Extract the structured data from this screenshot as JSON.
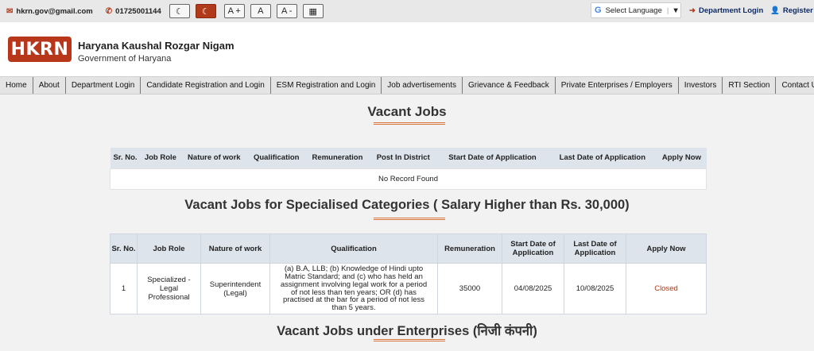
{
  "topbar": {
    "email": "hkrn.gov@gmail.com",
    "phone": "01725001144",
    "buttons": [
      "☾",
      "☾",
      "A +",
      "A",
      "A -",
      "▦"
    ],
    "language": {
      "g": "G",
      "label": "Select Language",
      "arrow": "▼"
    },
    "department_login": "Department Login",
    "register": "Register"
  },
  "header": {
    "logo_text": "HKRN",
    "org_name": "Haryana Kaushal Rozgar Nigam",
    "org_sub": "Government of Haryana"
  },
  "nav": [
    "Home",
    "About",
    "Department Login",
    "Candidate Registration and Login",
    "ESM Registration and Login",
    "Job advertisements",
    "Grievance & Feedback",
    "Private Enterprises / Employers",
    "Investors",
    "RTI Section",
    "Contact Us"
  ],
  "vacant_jobs": {
    "title": "Vacant Jobs",
    "headers": [
      "Sr. No.",
      "Job Role",
      "Nature of work",
      "Qualification",
      "Remuneration",
      "Post In District",
      "Start Date of Application",
      "Last Date of Application",
      "Apply Now"
    ],
    "empty_text": "No Record Found"
  },
  "specialised": {
    "title": "Vacant Jobs for Specialised Categories ( Salary Higher than  Rs. 30,000)",
    "headers": [
      "Sr. No.",
      "Job Role",
      "Nature of work",
      "Qualification",
      "Remuneration",
      "Start Date of Application",
      "Last Date of Application",
      "Apply Now"
    ],
    "row": {
      "sr": "1",
      "role": "Specialized - Legal Professional",
      "nature": "Superintendent (Legal)",
      "qualification": "(a) B.A, LLB; (b) Knowledge of Hindi upto Matric Standard; and (c) who has held an assignment involving legal work for a period of not less than ten years; OR (d) has practised at the bar for a period of not less than 5 years.",
      "remuneration": "35000",
      "start": "04/08/2025",
      "last": "10/08/2025",
      "apply": "Closed"
    }
  },
  "enterprises": {
    "title": "Vacant Jobs under Enterprises (निजी कंपनी)"
  },
  "colors": {
    "accent": "#b8371a",
    "nav_bg": "#e4e4e4",
    "table_header": "#dde4ec",
    "underline": "#d8753c"
  }
}
